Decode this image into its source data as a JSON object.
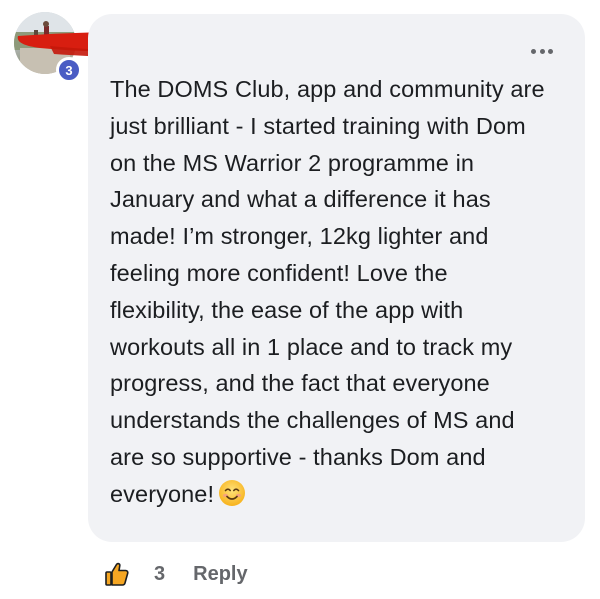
{
  "comment": {
    "avatar_badge": "3",
    "lines": [
      "The DOMS Club, app and community are",
      "just brilliant - I started training with Dom",
      "on the MS Warrior 2 programme in",
      "January and what a difference it has",
      "made! I’m stronger, 12kg lighter and",
      "feeling more confident! Love the",
      "flexibility, the ease of the app with",
      "workouts all in 1 place and to track my",
      "progress, and the fact that everyone",
      "understands the challenges of MS and",
      "are so supportive - thanks Dom and",
      "everyone!"
    ],
    "emoji": "smiling-face-emoji"
  },
  "actions": {
    "like_count": "3",
    "reply_label": "Reply"
  },
  "colors": {
    "bubble_bg": "#f1f2f5",
    "text": "#1c1e21",
    "muted": "#65676b",
    "badge": "#4a5cc4",
    "redaction": "#d81e10"
  }
}
